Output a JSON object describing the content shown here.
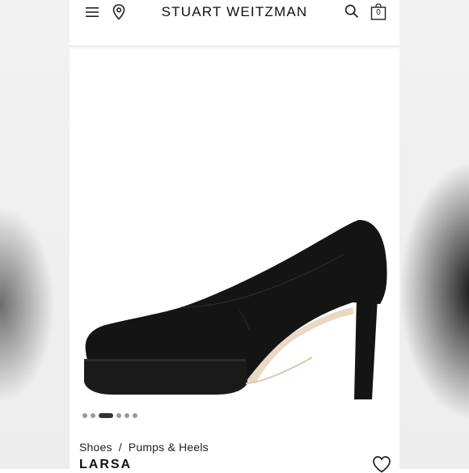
{
  "header": {
    "brand": "STUART WEITZMAN",
    "bag_count": "0",
    "icons": [
      "menu-icon",
      "location-pin-icon",
      "search-icon",
      "shopping-bag-icon"
    ]
  },
  "product": {
    "image_alt": "black suede platform pump, side view",
    "carousel": {
      "total": 6,
      "active_index": 2
    },
    "breadcrumb": {
      "category": "Shoes",
      "separator": "/",
      "subcategory": "Pumps & Heels"
    },
    "name": "LARSA",
    "wishlist_icon": "heart-icon"
  },
  "colors": {
    "text": "#111111",
    "shoe": "#141414",
    "sole_edge": "#e8d9c4",
    "dot_active": "#333333",
    "dot_inactive": "#9a9a9a"
  }
}
